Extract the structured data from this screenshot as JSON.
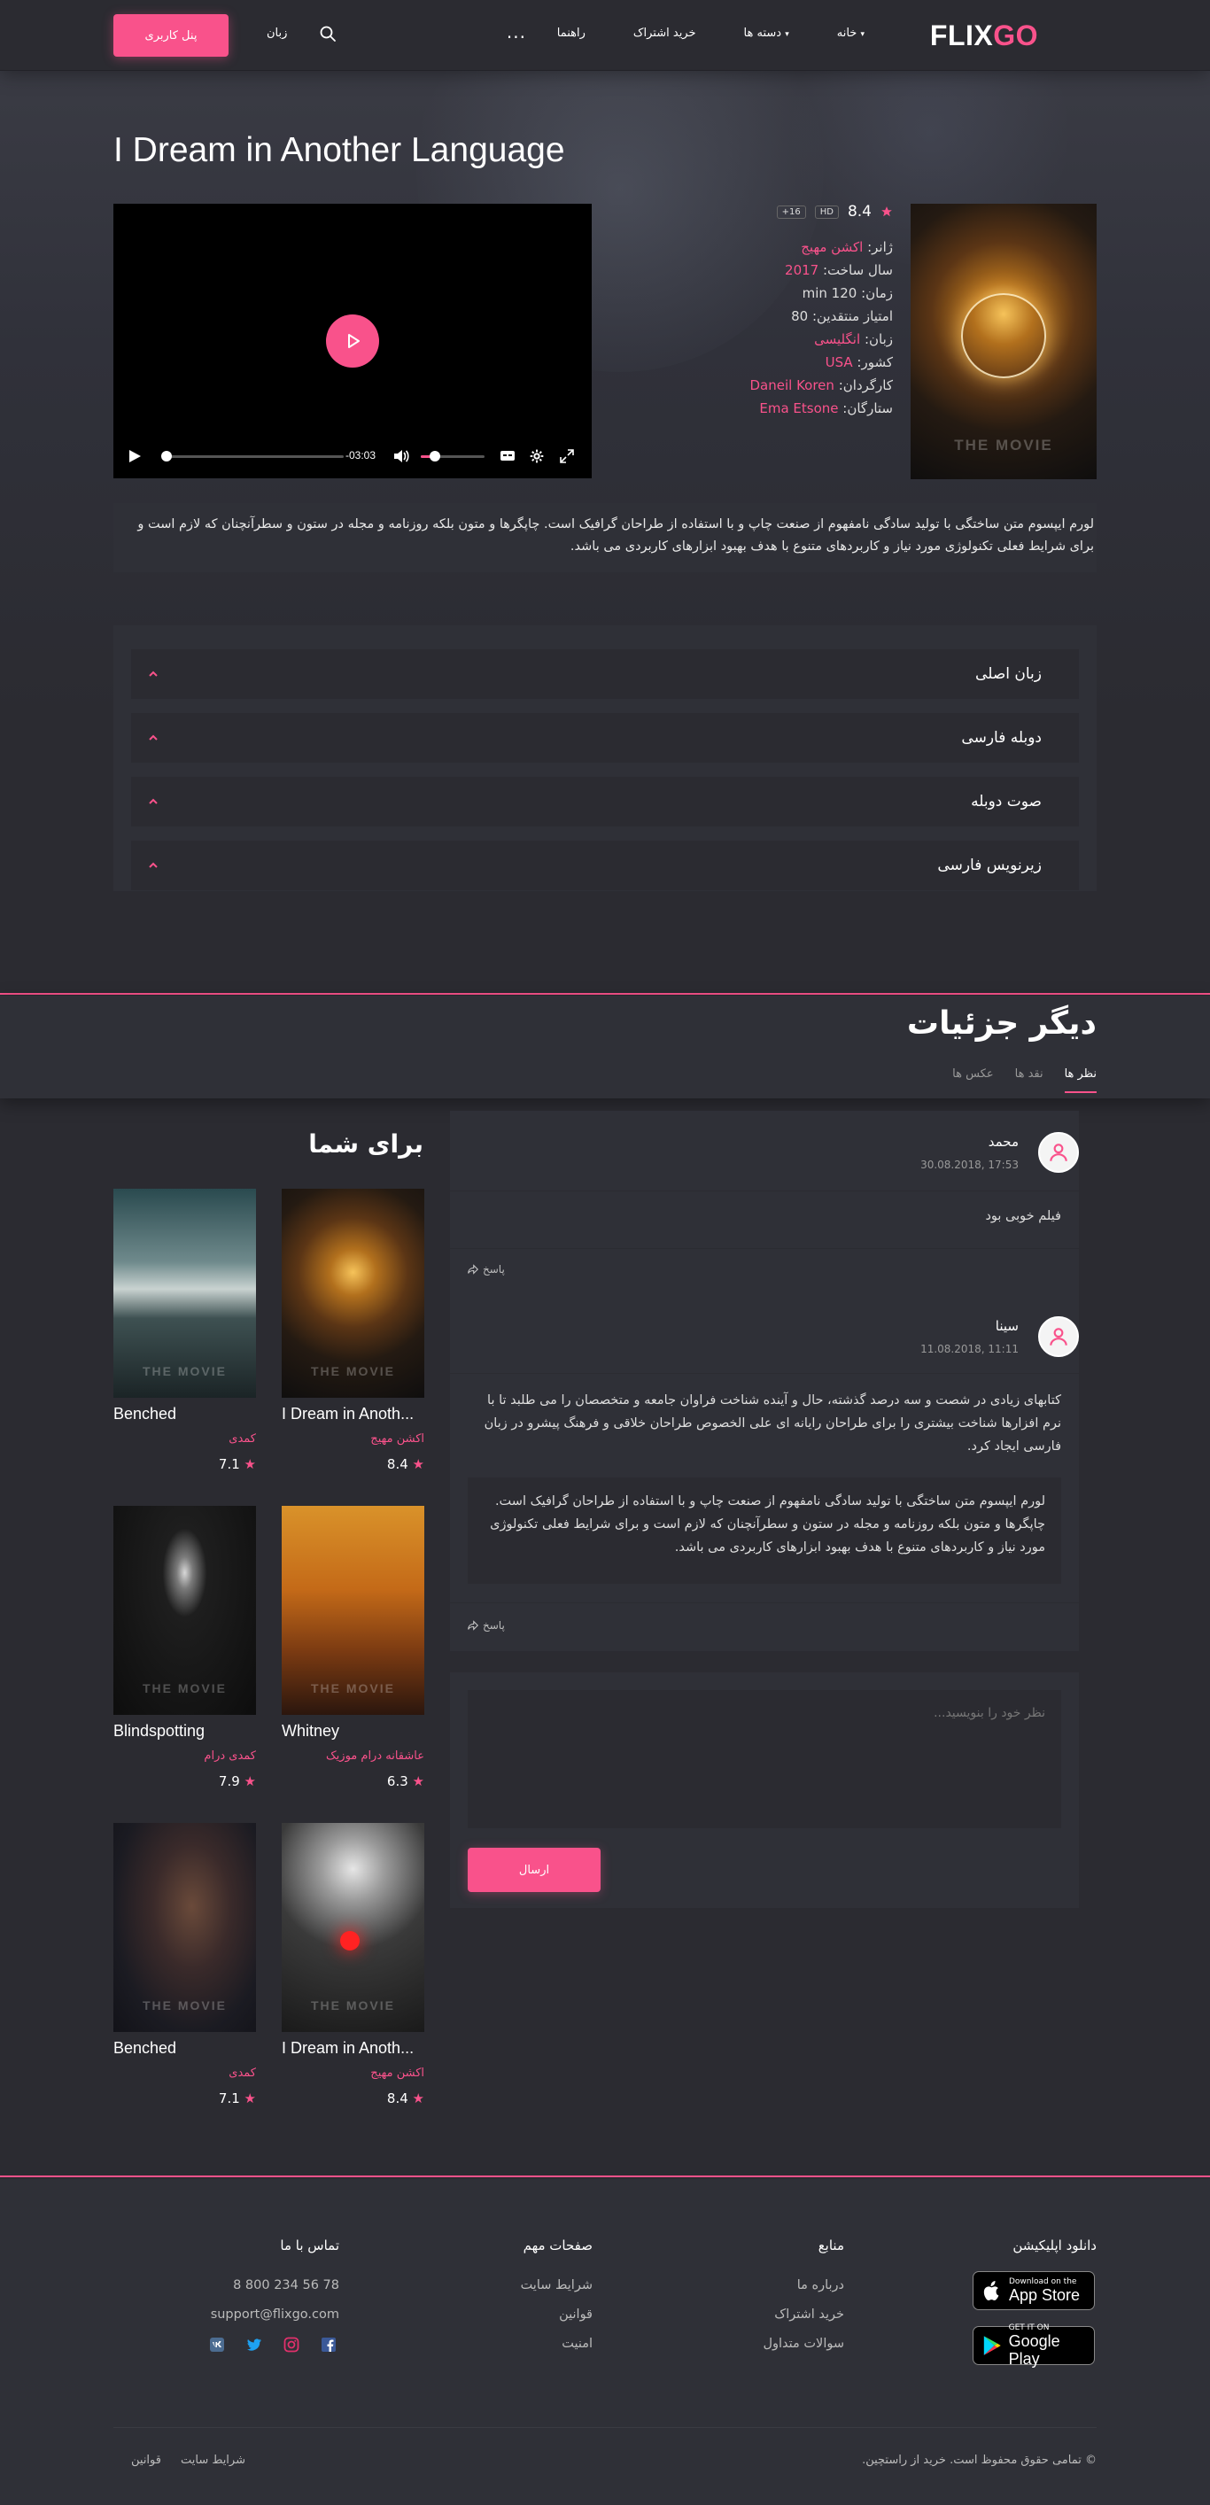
{
  "header": {
    "logo": {
      "part1": "FLIX",
      "part2": "GO"
    },
    "nav": [
      "خانه",
      "دسته ها",
      "راهنما",
      "خرید اشتراک"
    ],
    "more": "...",
    "language": "زبان",
    "user_panel": "پنل کاربری"
  },
  "movie": {
    "title": "I Dream in Another Language",
    "poster_watermark": "THE MOVIE",
    "rating": "8.4",
    "badges": [
      "HD",
      "+16"
    ],
    "meta": [
      {
        "key": "ژانر:",
        "value": "اکشن مهیج",
        "pink": true
      },
      {
        "key": "سال ساخت:",
        "value": "2017",
        "pink": true
      },
      {
        "key": "زمان:",
        "value": "120 min",
        "pink": false
      },
      {
        "key": "امتیاز منتقدین:",
        "value": "80",
        "pink": false
      },
      {
        "key": "زبان:",
        "value": "انگلیسی",
        "pink": true
      },
      {
        "key": "کشور:",
        "value": "USA",
        "pink": true
      },
      {
        "key": "کارگردان:",
        "value": "Daneil Koren",
        "pink": true
      },
      {
        "key": "ستارگان:",
        "value": "Ema Etsone",
        "pink": true
      }
    ],
    "player_time": "-03:03",
    "description": "لورم ایپسوم متن ساختگی با تولید سادگی نامفهوم از صنعت چاپ و با استفاده از طراحان گرافیک است. چاپگرها و متون بلکه روزنامه و مجله در ستون و سطرآنچنان که لازم است و برای شرایط فعلی تکنولوژی مورد نیاز و کاربردهای متنوع با هدف بهبود ابزارهای کاربردی می باشد."
  },
  "accordion": [
    "زبان اصلی",
    "دوبله فارسی",
    "صوت دوبله",
    "زیرنویس فارسی"
  ],
  "details": {
    "title": "دیگر جزئیات",
    "tabs": [
      "نظر ها",
      "نقد ها",
      "عکس ها"
    ]
  },
  "comments": [
    {
      "name": "محمد",
      "date": "30.08.2018, 17:53",
      "text": "فیلم خوبی بود",
      "reply": "پاسخ"
    },
    {
      "name": "سینا",
      "date": "11.08.2018, 11:11",
      "text": "کتابهای زیادی در شصت و سه درصد گذشته، حال و آینده شناخت فراوان جامعه و متخصصان را می طلبد تا با نرم افزارها شناخت بیشتری را برای طراحان رایانه ای علی الخصوص طراحان خلاقی و فرهنگ پیشرو در زبان فارسی ایجاد کرد.",
      "quote": "لورم ایپسوم متن ساختگی با تولید سادگی نامفهوم از صنعت چاپ و با استفاده از طراحان گرافیک است. چاپگرها و متون بلکه روزنامه و مجله در ستون و سطرآنچنان که لازم است و برای شرایط فعلی تکنولوژی مورد نیاز و کاربردهای متنوع با هدف بهبود ابزارهای کاربردی می باشد.",
      "reply": "پاسخ"
    }
  ],
  "comment_form": {
    "placeholder": "نظر خود را بنویسید...",
    "submit": "ارسال"
  },
  "for_you": {
    "title": "برای شما",
    "watermark": "THE MOVIE",
    "cards": [
      {
        "title": "I Dream in Anoth...",
        "genres": "اکشن  مهیج",
        "rating": "8.4"
      },
      {
        "title": "Benched",
        "genres": "کمدی",
        "rating": "7.1"
      },
      {
        "title": "Whitney",
        "genres": "عاشقانه  درام  موزیک",
        "rating": "6.3"
      },
      {
        "title": "Blindspotting",
        "genres": "کمدی  درام",
        "rating": "7.9"
      },
      {
        "title": "I Dream in Anoth...",
        "genres": "اکشن  مهیج",
        "rating": "8.4"
      },
      {
        "title": "Benched",
        "genres": "کمدی",
        "rating": "7.1"
      }
    ]
  },
  "footer": {
    "apps_title": "دانلود اپلیکیشن",
    "appstore": {
      "small": "Download on the",
      "big": "App Store"
    },
    "googleplay": {
      "small": "GET IT ON",
      "big": "Google Play"
    },
    "resources": {
      "title": "منابع",
      "links": [
        "درباره ما",
        "خرید اشتراک",
        "سوالات متداول"
      ]
    },
    "pages": {
      "title": "صفحات مهم",
      "links": [
        "شرایط سایت",
        "قوانین",
        "امنیت"
      ]
    },
    "contact": {
      "title": "تماس با ما",
      "phone": "8 800 234 56 78",
      "email": "support@flixgo.com"
    },
    "copyright": "© تمامی حقوق محفوظ است. خرید از راستچین.",
    "bottom_links": [
      "قوانین",
      "شرایط سایت"
    ]
  },
  "colors": {
    "accent": "#f9528b",
    "background": "#2b2b31",
    "panel": "#2f3037"
  }
}
